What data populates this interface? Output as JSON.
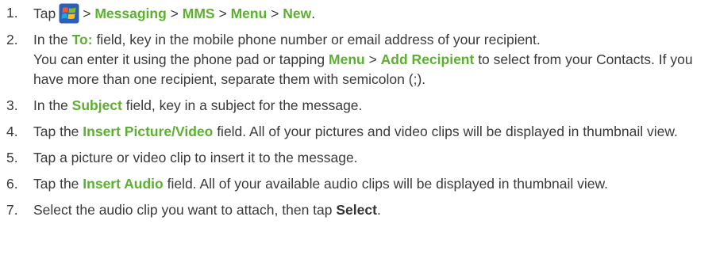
{
  "steps": [
    {
      "num": "1.",
      "t1": "Tap",
      "icon": "windows-start-icon",
      "sep1": ">",
      "k1": "Messaging",
      "sep2": ">",
      "k2": "MMS",
      "sep3": ">",
      "k3": "Menu",
      "sep4": ">",
      "k4": "New",
      "t2": "."
    },
    {
      "num": "2.",
      "t1": "In the ",
      "k1": "To:",
      "t2": " field, key in the mobile phone number or email address of your recipient.",
      "t3": "You can enter it using the phone pad or tapping ",
      "k2": "Menu",
      "sep1": " > ",
      "k3": "Add Recipient",
      "t4": " to select from your Contacts. If you have more than one recipient, separate them with semicolon (;)."
    },
    {
      "num": "3.",
      "t1": "In the ",
      "k1": "Subject",
      "t2": " field, key in a subject for the message."
    },
    {
      "num": "4.",
      "t1": "Tap the ",
      "k1": "Insert Picture/Video",
      "t2": " field. All of your pictures and video clips will be displayed in thumbnail view."
    },
    {
      "num": "5.",
      "t1": "Tap a picture or video clip to insert it to the message."
    },
    {
      "num": "6.",
      "t1": "Tap the ",
      "k1": "Insert Audio",
      "t2": " field. All of your available audio clips will be displayed in thumbnail view."
    },
    {
      "num": "7.",
      "t1": "Select the audio clip you want to attach, then tap ",
      "k1": "Select",
      "t2": "."
    }
  ],
  "colors": {
    "keyword": "#5cb030",
    "text": "#3a3a3a"
  }
}
